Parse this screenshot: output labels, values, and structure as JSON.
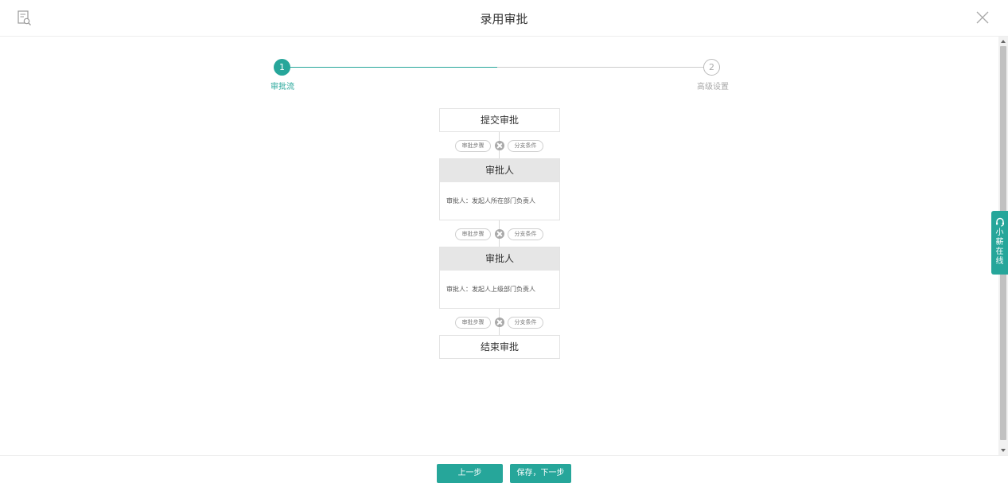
{
  "header": {
    "title": "录用审批"
  },
  "steps": {
    "items": [
      {
        "number": "1",
        "label": "审批流"
      },
      {
        "number": "2",
        "label": "高级设置"
      }
    ]
  },
  "flow": {
    "start_label": "提交审批",
    "end_label": "结束审批",
    "connector": {
      "step_label": "审批步骤",
      "branch_label": "分支条件"
    },
    "approvers": [
      {
        "title": "审批人",
        "detail": "审批人：发起人所在部门负责人"
      },
      {
        "title": "审批人",
        "detail": "审批人：发起人上级部门负责人"
      }
    ]
  },
  "side_widget": {
    "label": "小薪在线"
  },
  "footer": {
    "prev_label": "上一步",
    "next_label": "保存，下一步"
  },
  "colors": {
    "accent": "#26a69a",
    "node_header": "#e6e6e6"
  }
}
